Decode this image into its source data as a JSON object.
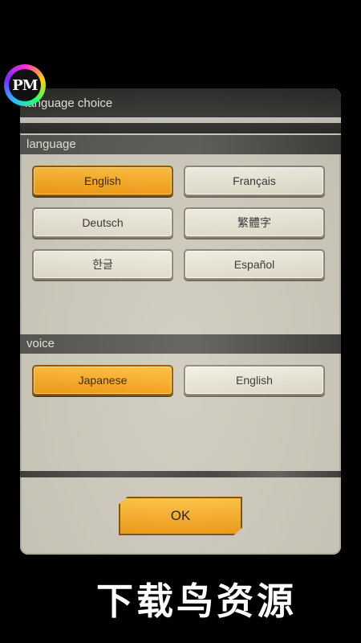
{
  "logo": {
    "text": "PM"
  },
  "dialog": {
    "title": "language choice",
    "sections": {
      "language": {
        "header": "language",
        "options": [
          "English",
          "Français",
          "Deutsch",
          "繁體字",
          "한글",
          "Español"
        ],
        "selected": "English"
      },
      "voice": {
        "header": "voice",
        "options": [
          "Japanese",
          "English"
        ],
        "selected": "Japanese"
      }
    },
    "ok_label": "OK"
  },
  "watermark": "下载鸟资源",
  "colors": {
    "selected_button": "#f5a321",
    "unselected_button": "#ece8d6",
    "dialog_bg": "#cfcbbd",
    "title_bar": "#2f2e2b"
  }
}
